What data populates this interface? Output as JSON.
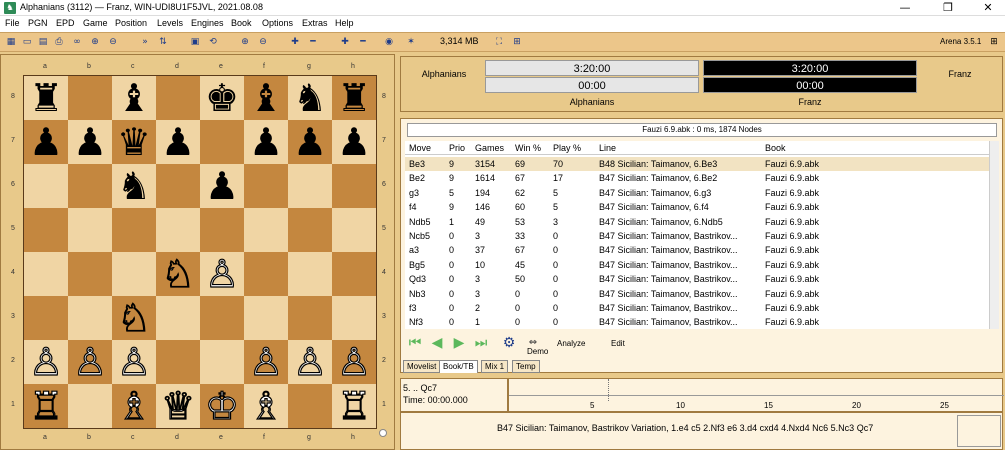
{
  "window": {
    "title": "Alphanians (3112)  —  Franz,   WIN-UDI8U1F5JVL,   2021.08.08",
    "controls": [
      "—",
      "❐",
      "✕"
    ]
  },
  "menu": [
    "File",
    "PGN",
    "EPD",
    "Game",
    "Position",
    "Levels",
    "Engines",
    "Book",
    "Options",
    "Extras",
    "Help"
  ],
  "toolbar": {
    "memory": "3,314 MB",
    "version": "Arena 3.5.1"
  },
  "board": {
    "files": [
      "a",
      "b",
      "c",
      "d",
      "e",
      "f",
      "g",
      "h"
    ],
    "ranks": [
      "8",
      "7",
      "6",
      "5",
      "4",
      "3",
      "2",
      "1"
    ],
    "position": [
      [
        "♜",
        "",
        "♝",
        "",
        "♚",
        "♝",
        "♞",
        "♜"
      ],
      [
        "♟",
        "♟",
        "♛",
        "♟",
        "",
        "♟",
        "♟",
        "♟"
      ],
      [
        "",
        "",
        "♞",
        "",
        "♟",
        "",
        "",
        ""
      ],
      [
        "",
        "",
        "",
        "",
        "",
        "",
        "",
        ""
      ],
      [
        "",
        "",
        "",
        "♘",
        "♙",
        "",
        "",
        ""
      ],
      [
        "",
        "",
        "♘",
        "",
        "",
        "",
        "",
        ""
      ],
      [
        "♙",
        "♙",
        "♙",
        "",
        "",
        "♙",
        "♙",
        "♙"
      ],
      [
        "♖",
        "",
        "♗",
        "♕",
        "♔",
        "♗",
        "",
        "♖"
      ]
    ],
    "colors": [
      [
        "b",
        "",
        "b",
        "",
        "b",
        "b",
        "b",
        "b"
      ],
      [
        "b",
        "b",
        "b",
        "b",
        "",
        "b",
        "b",
        "b"
      ],
      [
        "",
        "",
        "b",
        "",
        "b",
        "",
        "",
        ""
      ],
      [
        "",
        "",
        "",
        "",
        "",
        "",
        "",
        ""
      ],
      [
        "",
        "",
        "",
        "w",
        "w",
        "",
        "",
        ""
      ],
      [
        "",
        "",
        "w",
        "",
        "",
        "",
        "",
        ""
      ],
      [
        "w",
        "w",
        "w",
        "",
        "",
        "w",
        "w",
        "w"
      ],
      [
        "w",
        "",
        "w",
        "w",
        "w",
        "w",
        "",
        "w"
      ]
    ]
  },
  "clock": {
    "white_name": "Alphanians",
    "black_name": "Franz",
    "white_time": "3:20:00",
    "white_move_time": "00:00",
    "black_time": "3:20:00",
    "black_move_time": "00:00",
    "white_label": "Alphanians",
    "black_label": "Franz"
  },
  "book": {
    "header": "Fauzi 6.9.abk : 0 ms, 1874 Nodes",
    "columns": [
      "Move",
      "Prio",
      "Games",
      "Win %",
      "Play %",
      "Line",
      "Book"
    ],
    "rows": [
      [
        "Be3",
        "9",
        "3154",
        "69",
        "70",
        "B48  Sicilian: Taimanov, 6.Be3",
        "Fauzi 6.9.abk"
      ],
      [
        "Be2",
        "9",
        "1614",
        "67",
        "17",
        "B47  Sicilian: Taimanov, 6.Be2",
        "Fauzi 6.9.abk"
      ],
      [
        "g3",
        "5",
        "194",
        "62",
        "5",
        "B47  Sicilian: Taimanov, 6.g3",
        "Fauzi 6.9.abk"
      ],
      [
        "f4",
        "9",
        "146",
        "60",
        "5",
        "B47  Sicilian: Taimanov, 6.f4",
        "Fauzi 6.9.abk"
      ],
      [
        "Ndb5",
        "1",
        "49",
        "53",
        "3",
        "B47  Sicilian: Taimanov, 6.Ndb5",
        "Fauzi 6.9.abk"
      ],
      [
        "Ncb5",
        "0",
        "3",
        "33",
        "0",
        "B47  Sicilian: Taimanov, Bastrikov...",
        "Fauzi 6.9.abk"
      ],
      [
        "a3",
        "0",
        "37",
        "67",
        "0",
        "B47  Sicilian: Taimanov, Bastrikov...",
        "Fauzi 6.9.abk"
      ],
      [
        "Bg5",
        "0",
        "10",
        "45",
        "0",
        "B47  Sicilian: Taimanov, Bastrikov...",
        "Fauzi 6.9.abk"
      ],
      [
        "Qd3",
        "0",
        "3",
        "50",
        "0",
        "B47  Sicilian: Taimanov, Bastrikov...",
        "Fauzi 6.9.abk"
      ],
      [
        "Nb3",
        "0",
        "3",
        "0",
        "0",
        "B47  Sicilian: Taimanov, Bastrikov...",
        "Fauzi 6.9.abk"
      ],
      [
        "f3",
        "0",
        "2",
        "0",
        "0",
        "B47  Sicilian: Taimanov, Bastrikov...",
        "Fauzi 6.9.abk"
      ],
      [
        "Nf3",
        "0",
        "1",
        "0",
        "0",
        "B47  Sicilian: Taimanov, Bastrikov...",
        "Fauzi 6.9.abk"
      ]
    ],
    "demo_label": "Demo",
    "analyze_label": "Analyze",
    "edit_label": "Edit"
  },
  "tabs": [
    "Movelist",
    "Book/TB",
    "Mix 1",
    "Temp"
  ],
  "moveinfo": {
    "move": "5. .. Qc7",
    "time": "Time: 00:00.000"
  },
  "graph": {
    "ticks": [
      "5",
      "10",
      "15",
      "20",
      "25"
    ]
  },
  "line": "B47   Sicilian: Taimanov, Bastrikov Variation, 1.e4 c5 2.Nf3 e6 3.d4 cxd4 4.Nxd4 Nc6 5.Nc3 Qc7"
}
